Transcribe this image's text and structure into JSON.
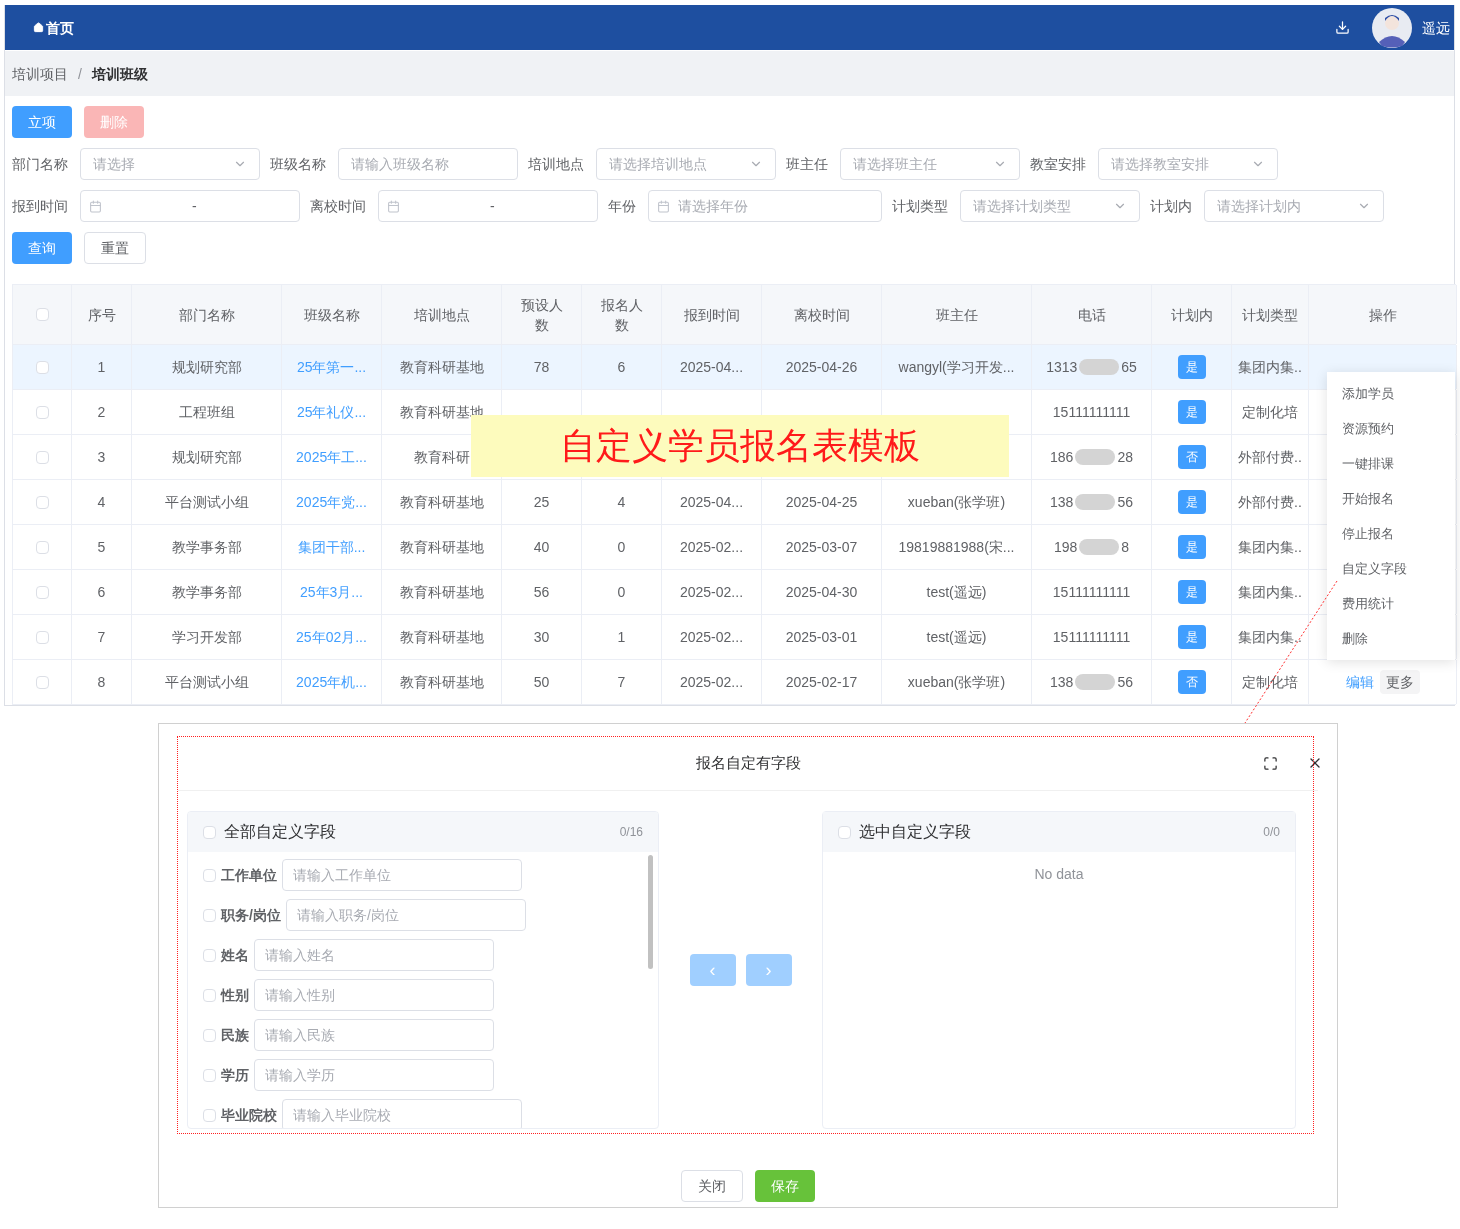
{
  "topbar": {
    "home": "首页",
    "user": "遥远"
  },
  "breadcrumb": [
    {
      "label": "培训项目",
      "current": false
    },
    {
      "label": "培训班级",
      "current": true
    }
  ],
  "breadcrumb_separator": "/",
  "actions": [
    {
      "label": "立项",
      "kind": "primary",
      "disabled": false
    },
    {
      "label": "删除",
      "kind": "danger",
      "disabled": true
    }
  ],
  "filters": [
    [
      {
        "label": "部门名称",
        "kind": "select",
        "placeholder": "请选择"
      },
      {
        "label": "班级名称",
        "kind": "input",
        "placeholder": "请输入班级名称"
      },
      {
        "label": "培训地点",
        "kind": "select",
        "placeholder": "请选择培训地点"
      },
      {
        "label": "班主任",
        "kind": "select",
        "placeholder": "请选择班主任"
      },
      {
        "label": "教室安排",
        "kind": "select",
        "placeholder": "请选择教室安排"
      }
    ],
    [
      {
        "label": "报到时间",
        "kind": "daterange",
        "separator": "-"
      },
      {
        "label": "离校时间",
        "kind": "daterange",
        "separator": "-"
      },
      {
        "label": "年份",
        "kind": "date",
        "placeholder": "请选择年份"
      },
      {
        "label": "计划类型",
        "kind": "select",
        "placeholder": "请选择计划类型"
      },
      {
        "label": "计划内",
        "kind": "select",
        "placeholder": "请选择计划内"
      }
    ]
  ],
  "search_buttons": [
    {
      "label": "查询",
      "kind": "primary"
    },
    {
      "label": "重置",
      "kind": "default"
    }
  ],
  "table": {
    "all_checked": false,
    "columns": [
      "序号",
      "部门名称",
      "班级名称",
      "培训地点",
      "预设人数",
      "报名人数",
      "报到时间",
      "离校时间",
      "班主任",
      "电话",
      "计划内",
      "计划类型",
      "操作"
    ],
    "rows": [
      {
        "checked": false,
        "selected": true,
        "no": "1",
        "dept": "规划研究部",
        "class_name": "25年第一...",
        "location": "教育科研基地",
        "planned": "78",
        "enrolled": "6",
        "report_date": "2025-04...",
        "leave_date": "2025-04-26",
        "teacher": "wangyl(学习开发...",
        "phone": {
          "start": "1313",
          "end": "65",
          "blurred": true
        },
        "in_plan": "是",
        "plan_type": "集团内集.."
      },
      {
        "checked": false,
        "selected": false,
        "no": "2",
        "dept": "工程班组",
        "class_name": "25年礼仪...",
        "location": "教育科研基地",
        "phone": {
          "start": "15111111111",
          "blurred": false
        },
        "in_plan": "是",
        "plan_type": "定制化培"
      },
      {
        "checked": false,
        "selected": false,
        "no": "3",
        "dept": "规划研究部",
        "class_name": "2025年工...",
        "location": "教育科研",
        "phone": {
          "start": "186",
          "end": "28",
          "blurred": true
        },
        "in_plan": "否",
        "plan_type": "外部付费.."
      },
      {
        "checked": false,
        "selected": false,
        "no": "4",
        "dept": "平台测试小组",
        "class_name": "2025年党...",
        "location": "教育科研基地",
        "planned": "25",
        "enrolled": "4",
        "report_date": "2025-04...",
        "leave_date": "2025-04-25",
        "teacher": "xueban(张学班)",
        "phone": {
          "start": "138",
          "end": "56",
          "blurred": true
        },
        "in_plan": "是",
        "plan_type": "外部付费.."
      },
      {
        "checked": false,
        "selected": false,
        "no": "5",
        "dept": "教学事务部",
        "class_name": "集团干部...",
        "location": "教育科研基地",
        "planned": "40",
        "enrolled": "0",
        "report_date": "2025-02...",
        "leave_date": "2025-03-07",
        "teacher": "19819881988(宋...",
        "phone": {
          "start": "198",
          "end": "8",
          "blurred": true
        },
        "in_plan": "是",
        "plan_type": "集团内集.."
      },
      {
        "checked": false,
        "selected": false,
        "no": "6",
        "dept": "教学事务部",
        "class_name": "25年3月...",
        "location": "教育科研基地",
        "planned": "56",
        "enrolled": "0",
        "report_date": "2025-02...",
        "leave_date": "2025-04-30",
        "teacher": "test(遥远)",
        "phone": {
          "start": "15111111111",
          "blurred": false
        },
        "in_plan": "是",
        "plan_type": "集团内集.."
      },
      {
        "checked": false,
        "selected": false,
        "no": "7",
        "dept": "学习开发部",
        "class_name": "25年02月...",
        "location": "教育科研基地",
        "planned": "30",
        "enrolled": "1",
        "report_date": "2025-02...",
        "leave_date": "2025-03-01",
        "teacher": "test(遥远)",
        "phone": {
          "start": "15111111111",
          "blurred": false
        },
        "in_plan": "是",
        "plan_type": "集团内集.."
      },
      {
        "checked": false,
        "selected": false,
        "no": "8",
        "dept": "平台测试小组",
        "class_name": "2025年机...",
        "location": "教育科研基地",
        "planned": "50",
        "enrolled": "7",
        "report_date": "2025-02...",
        "leave_date": "2025-02-17",
        "teacher": "xueban(张学班)",
        "phone": {
          "start": "138",
          "end": "56",
          "blurred": true
        },
        "in_plan": "否",
        "plan_type": "定制化培",
        "actions": [
          "编辑",
          "更多"
        ]
      }
    ]
  },
  "annotation": "自定义学员报名表模板",
  "menu": {
    "items": [
      "添加学员",
      "资源预约",
      "一键排课",
      "开始报名",
      "停止报名",
      "自定义字段",
      "费用统计",
      "删除"
    ]
  },
  "dialog": {
    "title": "报名自定有字段",
    "left": {
      "title": "全部自定义字段",
      "count": "0/16",
      "checked": false,
      "fields": [
        {
          "label": "工作单位",
          "placeholder": "请输入工作单位",
          "checked": false
        },
        {
          "label": "职务/岗位",
          "placeholder": "请输入职务/岗位",
          "checked": false
        },
        {
          "label": "姓名",
          "placeholder": "请输入姓名",
          "checked": false
        },
        {
          "label": "性别",
          "placeholder": "请输入性别",
          "checked": false
        },
        {
          "label": "民族",
          "placeholder": "请输入民族",
          "checked": false
        },
        {
          "label": "学历",
          "placeholder": "请输入学历",
          "checked": false
        },
        {
          "label": "毕业院校",
          "placeholder": "请输入毕业院校",
          "checked": false
        }
      ]
    },
    "transfer_buttons": [
      {
        "label": "‹",
        "disabled": true
      },
      {
        "label": "›",
        "disabled": true
      }
    ],
    "right": {
      "title": "选中自定义字段",
      "count": "0/0",
      "checked": false,
      "empty": "No data"
    },
    "footer": [
      {
        "label": "关闭",
        "kind": "default"
      },
      {
        "label": "保存",
        "kind": "success"
      }
    ]
  }
}
